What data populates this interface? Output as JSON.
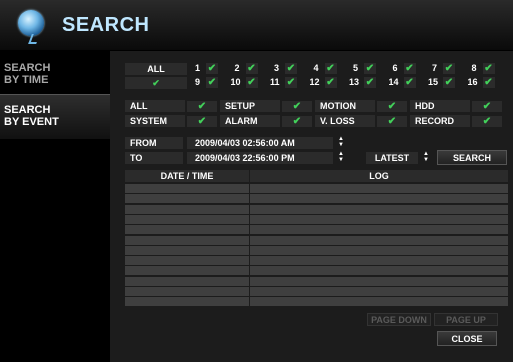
{
  "header": {
    "title": "SEARCH",
    "icon": "camera-lens-icon"
  },
  "sidebar": {
    "items": [
      {
        "line1": "SEARCH",
        "line2": "BY TIME"
      },
      {
        "line1": "SEARCH",
        "line2": "BY EVENT"
      }
    ]
  },
  "channels": {
    "all_label": "ALL",
    "numbers": [
      "1",
      "2",
      "3",
      "4",
      "5",
      "6",
      "7",
      "8",
      "9",
      "10",
      "11",
      "12",
      "13",
      "14",
      "15",
      "16"
    ]
  },
  "events": {
    "labels": [
      "ALL",
      "SETUP",
      "MOTION",
      "HDD",
      "SYSTEM",
      "ALARM",
      "V. LOSS",
      "RECORD"
    ],
    "check": "✔"
  },
  "range": {
    "from_label": "FROM",
    "from_value": "2009/04/03  02:56:00 AM",
    "to_label": "TO",
    "to_value": "2009/04/03  22:56:00 PM",
    "latest_label": "LATEST",
    "search_label": "SEARCH"
  },
  "table": {
    "col_datetime": "DATE / TIME",
    "col_log": "LOG",
    "row_count": 12
  },
  "buttons": {
    "page_down": "PAGE DOWN",
    "page_up": "PAGE UP",
    "close": "CLOSE"
  },
  "colors": {
    "accent": "#bfe7ff",
    "check": "#42d05a",
    "panel": "#1c1c1c"
  }
}
